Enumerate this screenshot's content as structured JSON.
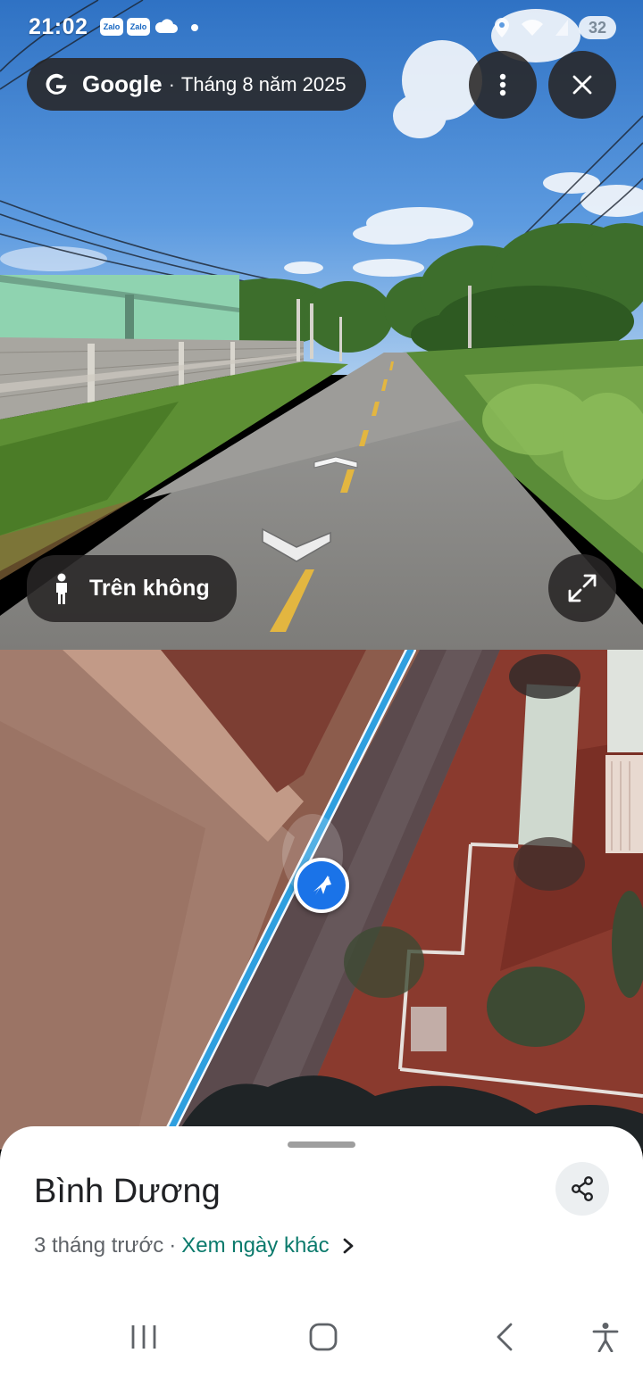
{
  "status_bar": {
    "time": "21:02",
    "notification_icons": [
      "Zalo",
      "Zalo"
    ],
    "battery": "32"
  },
  "street_view": {
    "provider": "Google",
    "separator": "·",
    "capture_date": "Tháng 8 năm 2025",
    "aerial_toggle_label": "Trên không"
  },
  "place": {
    "name": "Bình Dương",
    "age": "3 tháng trước",
    "separator": "·",
    "other_dates_link": "Xem ngày khác"
  },
  "colors": {
    "accent": "#1a73e8",
    "link": "#0b7a6c",
    "chip_bg": "#282626"
  }
}
